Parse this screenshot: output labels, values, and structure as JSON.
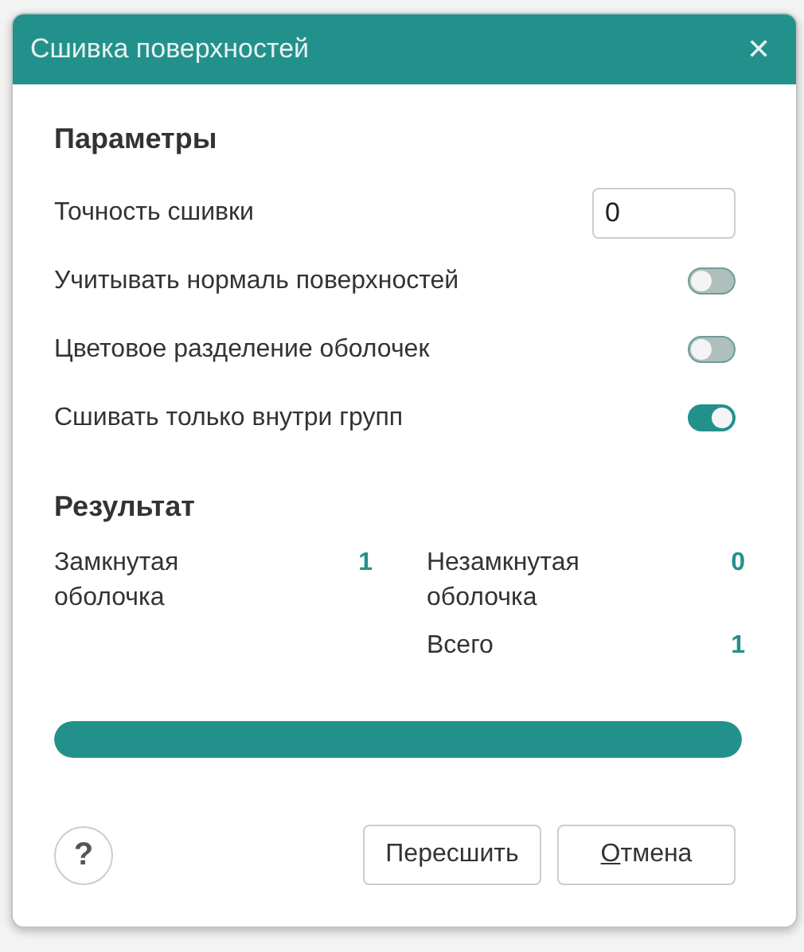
{
  "window": {
    "title": "Сшивка поверхностей",
    "close_glyph": "✕"
  },
  "parameters": {
    "heading": "Параметры",
    "fields": [
      {
        "kind": "input",
        "label": "Точность сшивки",
        "value": "0"
      },
      {
        "kind": "toggle",
        "label": "Учитывать нормаль поверхностей",
        "on": false
      },
      {
        "kind": "toggle",
        "label": "Цветовое разделение оболочек",
        "on": false
      },
      {
        "kind": "toggle",
        "label": "Сшивать только внутри групп",
        "on": true
      }
    ]
  },
  "result": {
    "heading": "Результат",
    "items": [
      {
        "label": "Замкнутая оболочка",
        "value": "1"
      },
      {
        "label": "Незамкнутая оболочка",
        "value": "0"
      },
      {
        "label": "Всего",
        "value": "1"
      }
    ]
  },
  "progress": {
    "level": 1
  },
  "footer": {
    "help": "?",
    "buttons": [
      {
        "label": "Пересшить",
        "mnemonic_underlined": false
      },
      {
        "label": "Отмена",
        "mnemonic_underlined": true
      }
    ]
  }
}
